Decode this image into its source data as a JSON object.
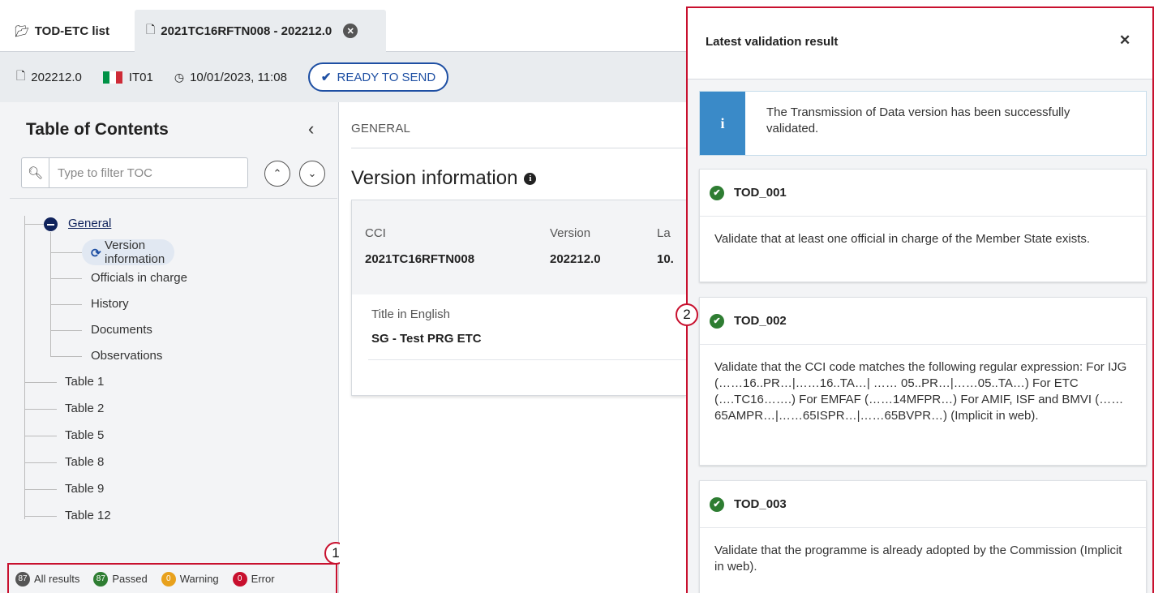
{
  "tabs": {
    "list_label": "TOD-ETC list",
    "active_label": "2021TC16RFTN008 - 202212.0"
  },
  "info_bar": {
    "version": "202212.0",
    "country_code": "IT01",
    "datetime": "10/01/2023, 11:08",
    "status": "READY TO SEND",
    "flag_colors": [
      "#009246",
      "#ffffff",
      "#ce2b37"
    ],
    "status_color": "#1e4fa3"
  },
  "toc": {
    "title": "Table of Contents",
    "filter_placeholder": "Type to filter TOC",
    "group_label": "General",
    "selected_item": "Version information",
    "sub_items": [
      "Officials in charge",
      "History",
      "Documents",
      "Observations"
    ],
    "tables": [
      "Table 1",
      "Table 2",
      "Table 5",
      "Table 8",
      "Table 9",
      "Table 12"
    ]
  },
  "results": {
    "all_count": "87",
    "all_label": "All results",
    "passed_count": "87",
    "passed_label": "Passed",
    "warning_count": "0",
    "warning_label": "Warning",
    "error_count": "0",
    "error_label": "Error",
    "colors": {
      "all": "#555555",
      "passed": "#2e7d32",
      "warning": "#e8a11c",
      "error": "#c8102e"
    }
  },
  "callouts": {
    "one": "1",
    "two": "2"
  },
  "main": {
    "breadcrumb": "GENERAL",
    "title": "Version information",
    "cci_label": "CCI",
    "cci_value": "2021TC16RFTN008",
    "version_label": "Version",
    "version_value": "202212.0",
    "last_label_partial": "La",
    "last_value_partial": "10.",
    "title_en_label": "Title in English",
    "title_en_value": "SG - Test PRG ETC"
  },
  "validation": {
    "title": "Latest validation result",
    "alert_text": "The Transmission of Data version has been successfully validated.",
    "rules": [
      {
        "code": "TOD_001",
        "description": "Validate that at least one official in charge of the Member State exists."
      },
      {
        "code": "TOD_002",
        "description": "Validate that the CCI code matches the following regular expression: For IJG (……16..PR…|……16..TA…| …… 05..PR…|……05..TA…) For ETC (….TC16…….) For EMFAF (……14MFPR…) For AMIF, ISF and BMVI (…… 65AMPR…|……65ISPR…|……65BVPR…) (Implicit in web)."
      },
      {
        "code": "TOD_003",
        "description": "Validate that the programme is already adopted by the Commission (Implicit in web)."
      }
    ]
  }
}
